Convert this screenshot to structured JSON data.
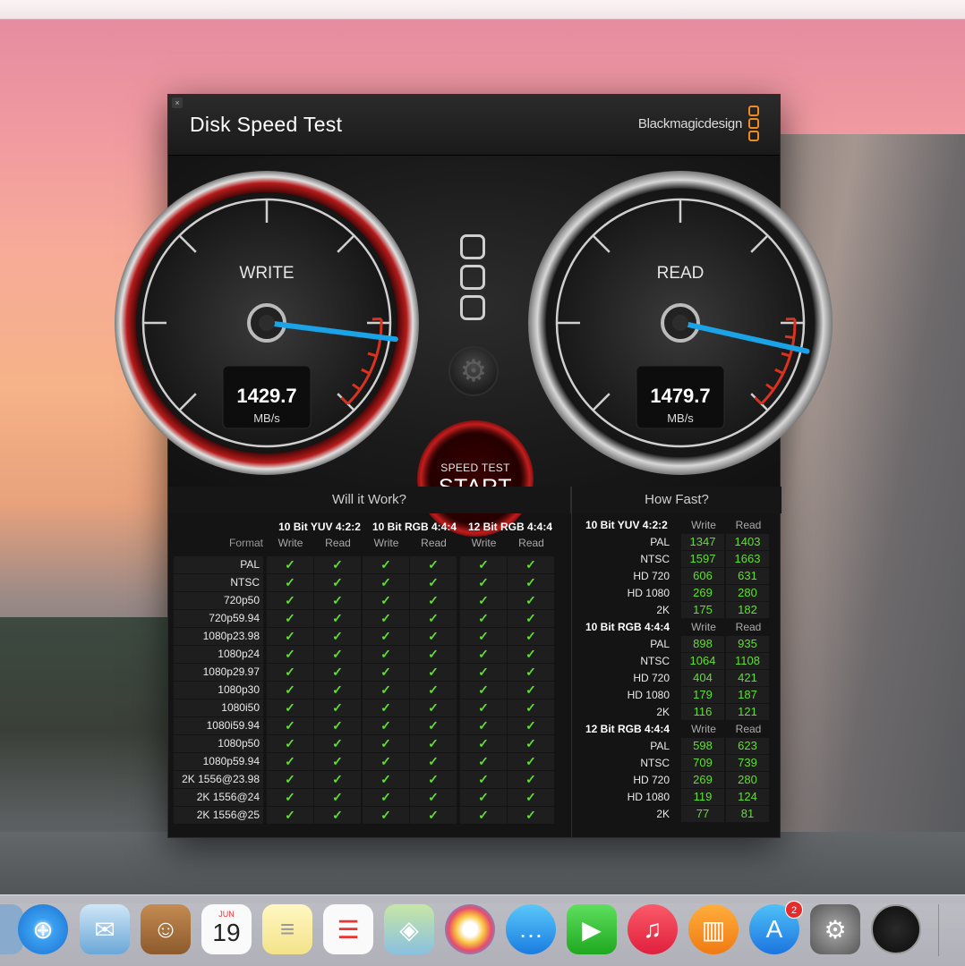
{
  "window": {
    "title": "Disk Speed Test",
    "brand": "Blackmagicdesign",
    "close_label": "×"
  },
  "gauges": {
    "write": {
      "label": "WRITE",
      "value": "1429.7",
      "unit": "MB/s",
      "needle_fraction": 0.86
    },
    "read": {
      "label": "READ",
      "value": "1479.7",
      "unit": "MB/s",
      "needle_fraction": 0.88
    }
  },
  "start_button": {
    "small": "SPEED TEST",
    "big": "START"
  },
  "colors": {
    "accent_orange": "#f08a24",
    "check_green": "#5fe02e",
    "needle_blue": "#1aa3e6",
    "start_red": "#c31d1d"
  },
  "will_it_work": {
    "title": "Will it Work?",
    "format_label": "Format",
    "groups": [
      "10 Bit YUV 4:2:2",
      "10 Bit RGB 4:4:4",
      "12 Bit RGB 4:4:4"
    ],
    "subheaders": [
      "Write",
      "Read",
      "Write",
      "Read",
      "Write",
      "Read"
    ],
    "check": "✓",
    "formats": [
      "PAL",
      "NTSC",
      "720p50",
      "720p59.94",
      "1080p23.98",
      "1080p24",
      "1080p29.97",
      "1080p30",
      "1080i50",
      "1080i59.94",
      "1080p50",
      "1080p59.94",
      "2K 1556@23.98",
      "2K 1556@24",
      "2K 1556@25"
    ]
  },
  "how_fast": {
    "title": "How Fast?",
    "write_label": "Write",
    "read_label": "Read",
    "groups": [
      {
        "name": "10 Bit YUV 4:2:2",
        "rows": [
          {
            "label": "PAL",
            "write": "1347",
            "read": "1403"
          },
          {
            "label": "NTSC",
            "write": "1597",
            "read": "1663"
          },
          {
            "label": "HD 720",
            "write": "606",
            "read": "631"
          },
          {
            "label": "HD 1080",
            "write": "269",
            "read": "280"
          },
          {
            "label": "2K",
            "write": "175",
            "read": "182"
          }
        ]
      },
      {
        "name": "10 Bit RGB 4:4:4",
        "rows": [
          {
            "label": "PAL",
            "write": "898",
            "read": "935"
          },
          {
            "label": "NTSC",
            "write": "1064",
            "read": "1108"
          },
          {
            "label": "HD 720",
            "write": "404",
            "read": "421"
          },
          {
            "label": "HD 1080",
            "write": "179",
            "read": "187"
          },
          {
            "label": "2K",
            "write": "116",
            "read": "121"
          }
        ]
      },
      {
        "name": "12 Bit RGB 4:4:4",
        "rows": [
          {
            "label": "PAL",
            "write": "598",
            "read": "623"
          },
          {
            "label": "NTSC",
            "write": "709",
            "read": "739"
          },
          {
            "label": "HD 720",
            "write": "269",
            "read": "280"
          },
          {
            "label": "HD 1080",
            "write": "119",
            "read": "124"
          },
          {
            "label": "2K",
            "write": "77",
            "read": "81"
          }
        ]
      }
    ]
  },
  "dock": {
    "calendar_month": "JUN",
    "calendar_day": "19",
    "app_store_badge": "2",
    "items": [
      "safari-icon",
      "mail-icon",
      "contacts-icon",
      "calendar-icon",
      "notes-icon",
      "reminders-icon",
      "maps-icon",
      "photos-icon",
      "messages-icon",
      "facetime-icon",
      "itunes-icon",
      "ibooks-icon",
      "app-store-icon",
      "system-preferences-icon",
      "disk-speed-test-icon"
    ]
  }
}
